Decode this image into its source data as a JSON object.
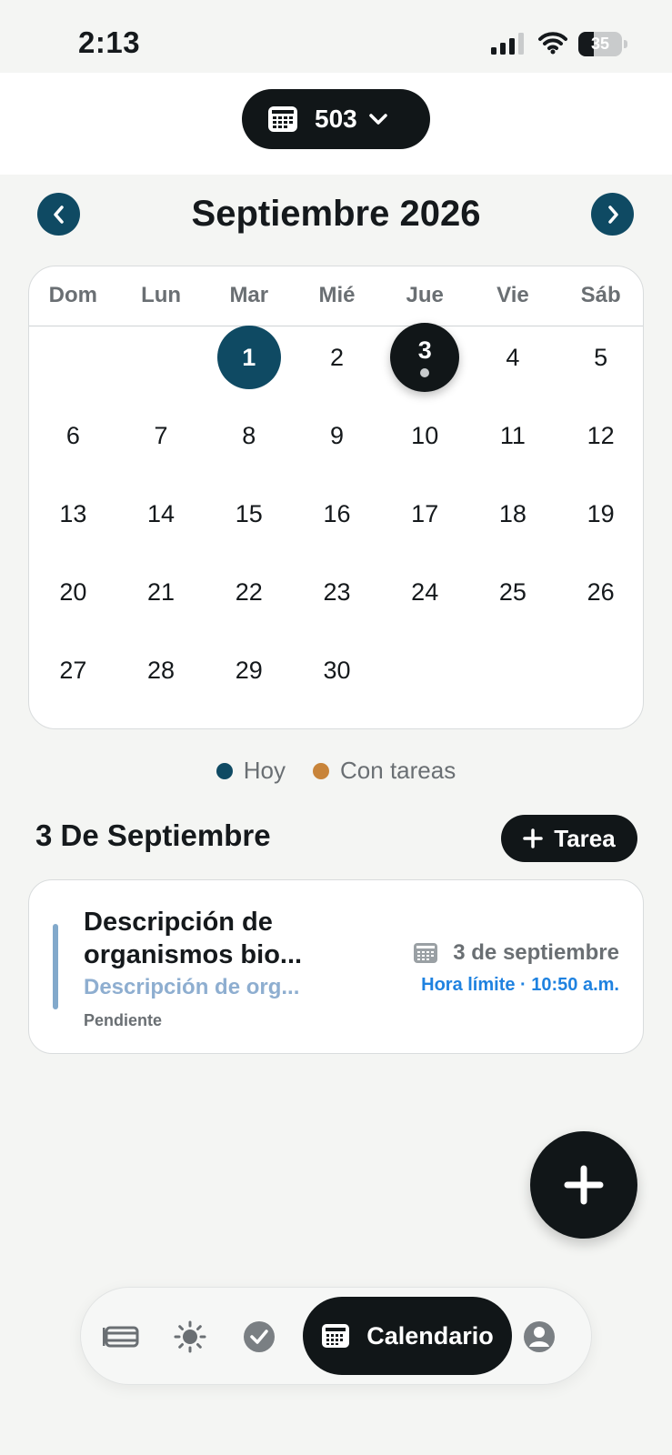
{
  "status_bar": {
    "time": "2:13",
    "battery": "35",
    "battery_level": 0.35
  },
  "header": {
    "group": "503"
  },
  "month": {
    "title": "Septiembre 2026"
  },
  "calendar": {
    "weekdays": [
      "Dom",
      "Lun",
      "Mar",
      "Mié",
      "Jue",
      "Vie",
      "Sáb"
    ],
    "days": [
      "1",
      "2",
      "3",
      "4",
      "5",
      "6",
      "7",
      "8",
      "9",
      "10",
      "11",
      "12",
      "13",
      "14",
      "15",
      "16",
      "17",
      "18",
      "19",
      "20",
      "21",
      "22",
      "23",
      "24",
      "25",
      "26",
      "27",
      "28",
      "29",
      "30"
    ],
    "today": "1",
    "selected": "3"
  },
  "legend": {
    "today_label": "Hoy",
    "tasks_label": "Con tareas",
    "today_color": "#0f4a63",
    "tasks_color": "#c8843a"
  },
  "day_section": {
    "title": "3 De Septiembre",
    "add_button": "Tarea"
  },
  "task": {
    "title": "Descripción de organismos bio...",
    "description": "Descripción de org...",
    "status": "Pendiente",
    "date": "3 de septiembre",
    "deadline": "Hora límite · 10:50 a.m."
  },
  "bottom_nav": {
    "active_label": "Calendario"
  },
  "icons": {
    "group_selector": "calendar-icon",
    "nav": [
      "list-icon",
      "sun-icon",
      "check-circle-icon",
      "calendar-icon",
      "profile-icon"
    ],
    "fab": "plus-icon"
  }
}
